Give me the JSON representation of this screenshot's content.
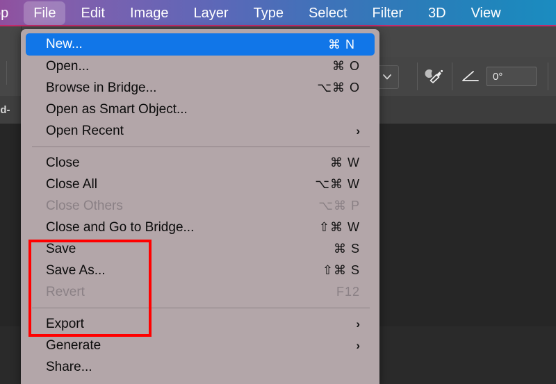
{
  "menubar": {
    "items": [
      {
        "label": "op",
        "active": false,
        "truncated": true
      },
      {
        "label": "File",
        "active": true
      },
      {
        "label": "Edit",
        "active": false
      },
      {
        "label": "Image",
        "active": false
      },
      {
        "label": "Layer",
        "active": false
      },
      {
        "label": "Type",
        "active": false
      },
      {
        "label": "Select",
        "active": false
      },
      {
        "label": "Filter",
        "active": false
      },
      {
        "label": "3D",
        "active": false
      },
      {
        "label": "View",
        "active": false
      }
    ],
    "gradient_start": "#8f4f9e",
    "gradient_end": "#1b8cc0",
    "accent_line": "#c32a6a"
  },
  "document_tab": {
    "label": "ed-"
  },
  "toolbar": {
    "dropdown_icon": "chevron-down-icon",
    "brush_icon": "brush-tool-icon",
    "angle_icon": "angle-icon",
    "angle_value": "0°"
  },
  "file_menu": {
    "panel_bg": "#b3a6a9",
    "highlight_color": "#1176e8",
    "groups": [
      {
        "items": [
          {
            "label": "New...",
            "shortcut": "⌘ N",
            "selected": true,
            "disabled": false,
            "submenu": false
          },
          {
            "label": "Open...",
            "shortcut": "⌘ O",
            "selected": false,
            "disabled": false,
            "submenu": false
          },
          {
            "label": "Browse in Bridge...",
            "shortcut": "⌥⌘ O",
            "selected": false,
            "disabled": false,
            "submenu": false
          },
          {
            "label": "Open as Smart Object...",
            "shortcut": "",
            "selected": false,
            "disabled": false,
            "submenu": false
          },
          {
            "label": "Open Recent",
            "shortcut": "",
            "selected": false,
            "disabled": false,
            "submenu": true
          }
        ]
      },
      {
        "items": [
          {
            "label": "Close",
            "shortcut": "⌘ W",
            "selected": false,
            "disabled": false,
            "submenu": false
          },
          {
            "label": "Close All",
            "shortcut": "⌥⌘ W",
            "selected": false,
            "disabled": false,
            "submenu": false
          },
          {
            "label": "Close Others",
            "shortcut": "⌥⌘ P",
            "selected": false,
            "disabled": true,
            "submenu": false
          },
          {
            "label": "Close and Go to Bridge...",
            "shortcut": "⇧⌘ W",
            "selected": false,
            "disabled": false,
            "submenu": false
          },
          {
            "label": "Save",
            "shortcut": "⌘ S",
            "selected": false,
            "disabled": false,
            "submenu": false
          },
          {
            "label": "Save As...",
            "shortcut": "⇧⌘ S",
            "selected": false,
            "disabled": false,
            "submenu": false
          },
          {
            "label": "Revert",
            "shortcut": "F12",
            "selected": false,
            "disabled": true,
            "submenu": false
          }
        ]
      },
      {
        "items": [
          {
            "label": "Export",
            "shortcut": "",
            "selected": false,
            "disabled": false,
            "submenu": true
          },
          {
            "label": "Generate",
            "shortcut": "",
            "selected": false,
            "disabled": false,
            "submenu": true
          },
          {
            "label": "Share...",
            "shortcut": "",
            "selected": false,
            "disabled": false,
            "submenu": false
          }
        ]
      }
    ]
  },
  "annotation": {
    "color": "#ff0000",
    "highlights": [
      "Save",
      "Save As...",
      "Revert",
      "Export"
    ]
  }
}
